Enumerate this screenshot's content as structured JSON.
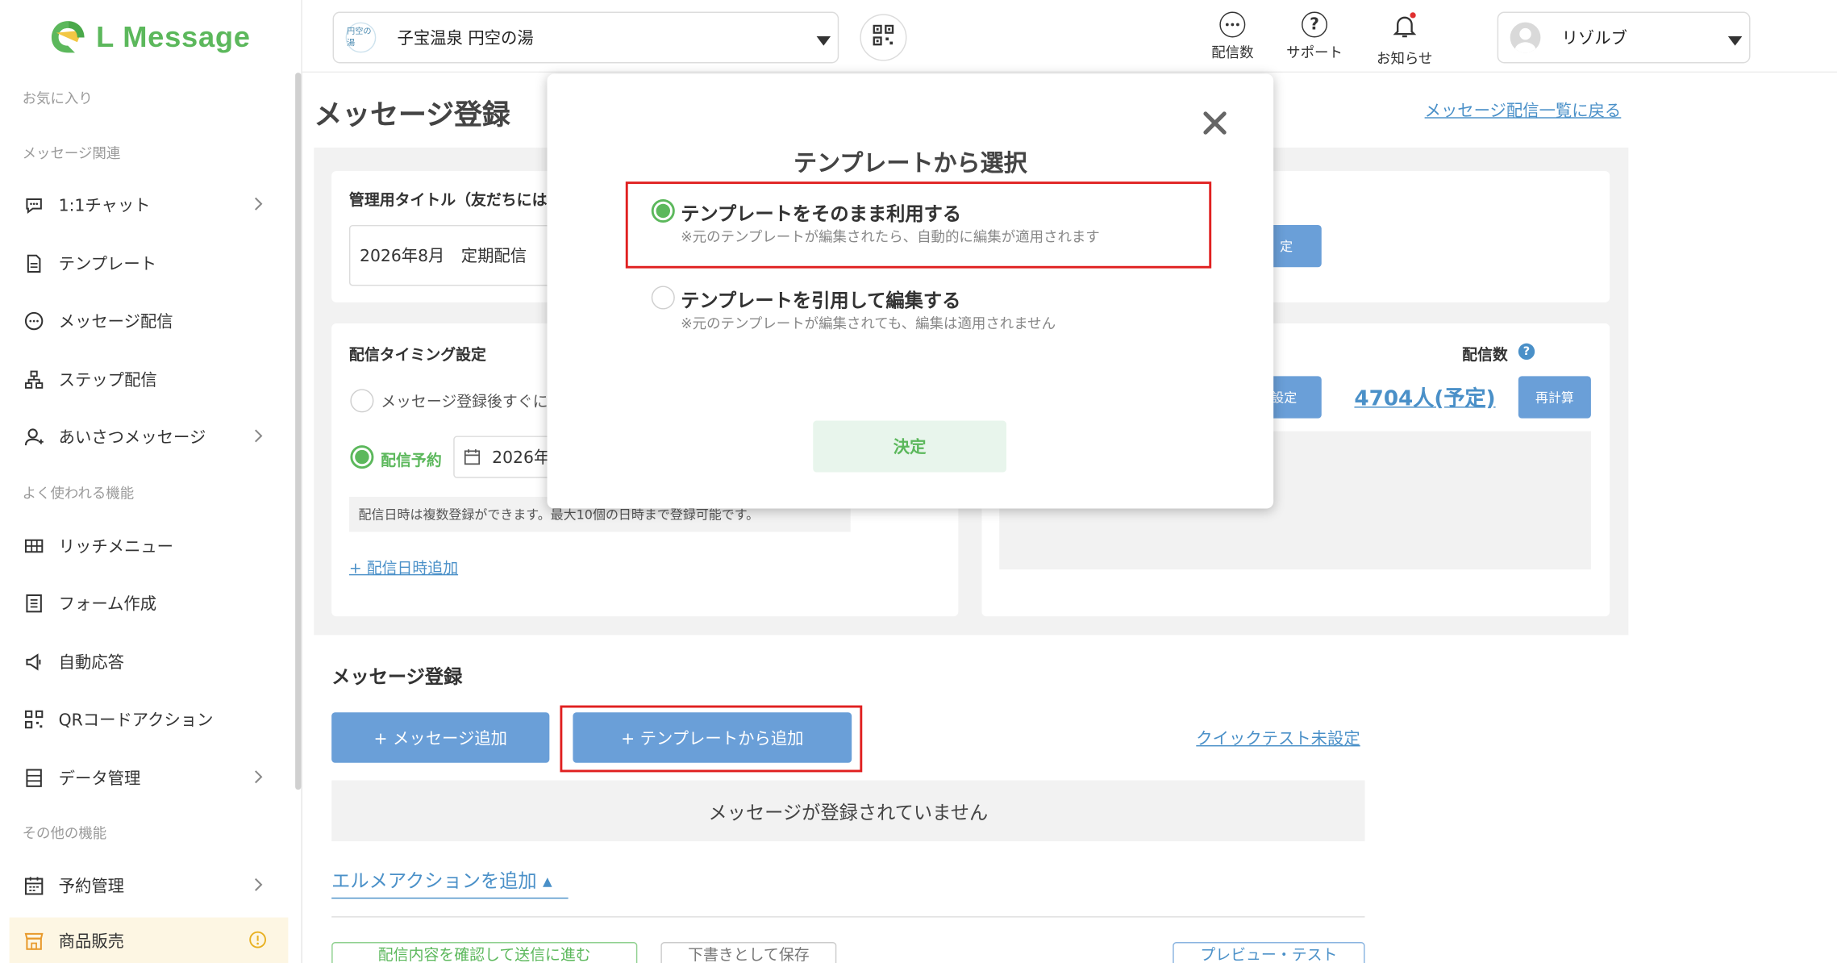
{
  "brand": {
    "name": "L Message",
    "color": "#5cb85c"
  },
  "sidebar": {
    "sections": {
      "favorites": "お気に入り",
      "message": "メッセージ関連",
      "frequent": "よく使われる機能",
      "other": "その他の機能"
    },
    "items": [
      {
        "label": "1:1チャット",
        "icon": "chat-bubble-icon",
        "chevron": true
      },
      {
        "label": "テンプレート",
        "icon": "document-icon",
        "chevron": false
      },
      {
        "label": "メッセージ配信",
        "icon": "message-dots-icon",
        "chevron": false
      },
      {
        "label": "ステップ配信",
        "icon": "hierarchy-icon",
        "chevron": false
      },
      {
        "label": "あいさつメッセージ",
        "icon": "user-add-icon",
        "chevron": true
      },
      {
        "label": "リッチメニュー",
        "icon": "grid-menu-icon",
        "chevron": false
      },
      {
        "label": "フォーム作成",
        "icon": "form-icon",
        "chevron": false
      },
      {
        "label": "自動応答",
        "icon": "megaphone-icon",
        "chevron": false
      },
      {
        "label": "QRコードアクション",
        "icon": "qr-code-icon",
        "chevron": false
      },
      {
        "label": "データ管理",
        "icon": "database-icon",
        "chevron": true
      },
      {
        "label": "予約管理",
        "icon": "calendar-icon",
        "chevron": true
      },
      {
        "label": "商品販売",
        "icon": "shop-icon",
        "chevron": false,
        "badge": "!"
      }
    ]
  },
  "header": {
    "account": {
      "name": "子宝温泉 円空の湯",
      "logo_text": "円空の湯"
    },
    "icons": [
      {
        "label": "配信数",
        "icon": "message-count-icon"
      },
      {
        "label": "サポート",
        "icon": "help-icon"
      },
      {
        "label": "お知らせ",
        "icon": "bell-icon"
      }
    ],
    "user": {
      "name": "リゾルブ"
    }
  },
  "main": {
    "page_title": "メッセージ登録",
    "back_link": "メッセージ配信一覧に戻る",
    "admin_title": {
      "label": "管理用タイトル（友だちには",
      "value": "2026年8月　定期配信"
    },
    "timing": {
      "label": "配信タイミング設定",
      "immediate": "メッセージ登録後すぐに",
      "scheduled": "配信予約",
      "date_value": "2026年",
      "note": "配信日時は複数登録ができます。最大10個の日時まで登録可能です。",
      "add_link": "+ 配信日時追加"
    },
    "right_card": {
      "set_button_top": "定",
      "count_label": "配信数",
      "set_button": "設定",
      "count_value": "4704人(予定)",
      "recalc_button": "再計算"
    },
    "message_section": {
      "title": "メッセージ登録",
      "add_message": "+ メッセージ追加",
      "add_template": "+ テンプレートから追加",
      "quick_test": "クイックテスト未設定",
      "empty": "メッセージが登録されていません",
      "action_link": "エルメアクションを追加 ▴"
    },
    "bottom_buttons": {
      "confirm": "配信内容を確認して送信に進む",
      "draft": "下書きとして保存",
      "preview": "プレビュー・テスト"
    }
  },
  "modal": {
    "title": "テンプレートから選択",
    "options": [
      {
        "title": "テンプレートをそのまま利用する",
        "sub": "※元のテンプレートが編集されたら、自動的に編集が適用されます",
        "selected": true
      },
      {
        "title": "テンプレートを引用して編集する",
        "sub": "※元のテンプレートが編集されても、編集は適用されません",
        "selected": false
      }
    ],
    "submit": "決定"
  },
  "colors": {
    "accent_green": "#5cb85c",
    "button_blue": "#6a9fd8",
    "link_blue": "#4a90c8",
    "highlight_red": "#e02020"
  }
}
